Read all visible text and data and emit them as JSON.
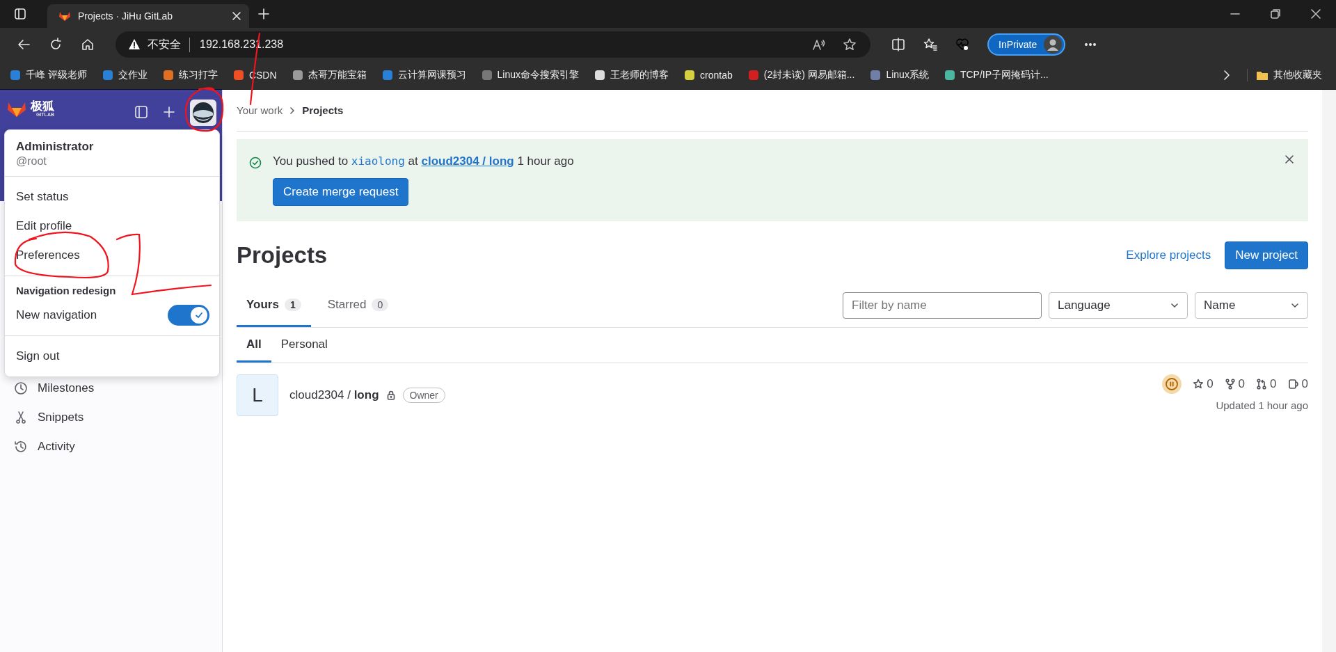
{
  "browser": {
    "tab_title": "Projects · JiHu GitLab",
    "security_label": "不安全",
    "url": "192.168.231.238",
    "profile_label": "InPrivate",
    "bookmarks": [
      {
        "label": "千峰 评级老师"
      },
      {
        "label": "交作业"
      },
      {
        "label": "练习打字"
      },
      {
        "label": "CSDN"
      },
      {
        "label": "杰哥万能宝箱"
      },
      {
        "label": "云计算网课预习"
      },
      {
        "label": "Linux命令搜索引擎"
      },
      {
        "label": "王老师的博客"
      },
      {
        "label": "crontab"
      },
      {
        "label": "(2封未读) 网易邮箱..."
      },
      {
        "label": "Linux系统"
      },
      {
        "label": "TCP/IP子网掩码计..."
      }
    ],
    "other_bookmarks": "其他收藏夹"
  },
  "sidebar": {
    "logo_text": "极狐",
    "logo_subtext": "GITLAB",
    "items": [
      {
        "label": "Milestones"
      },
      {
        "label": "Snippets"
      },
      {
        "label": "Activity"
      }
    ]
  },
  "user_menu": {
    "name": "Administrator",
    "username": "@root",
    "items": [
      {
        "label": "Set status"
      },
      {
        "label": "Edit profile"
      },
      {
        "label": "Preferences"
      }
    ],
    "section_title": "Navigation redesign",
    "toggle": {
      "label": "New navigation",
      "on": true
    },
    "sign_out": "Sign out"
  },
  "breadcrumb": [
    {
      "label": "Your work"
    },
    {
      "label": "Projects"
    }
  ],
  "alert": {
    "prefix": "You pushed to ",
    "branch": "xiaolong",
    "middle": " at ",
    "project": "cloud2304 / long",
    "suffix": " 1 hour ago",
    "button": "Create merge request"
  },
  "page_title": "Projects",
  "explore_link": "Explore projects",
  "new_button": "New project",
  "tabs": [
    {
      "label": "Yours",
      "count": "1",
      "selected": true
    },
    {
      "label": "Starred",
      "count": "0",
      "selected": false
    }
  ],
  "filter": {
    "placeholder": "Filter by name"
  },
  "dropdowns": [
    {
      "label": "Language"
    },
    {
      "label": "Name"
    }
  ],
  "subtabs": [
    {
      "label": "All",
      "selected": true
    },
    {
      "label": "Personal",
      "selected": false
    }
  ],
  "projects": [
    {
      "avatar_letter": "L",
      "title": "cloud2304 / **long**",
      "private": true,
      "role": "Owner",
      "stars": "0",
      "forks": "0",
      "merge_requests": "0",
      "issues": "0",
      "updated": "Updated 1 hour ago"
    }
  ]
}
